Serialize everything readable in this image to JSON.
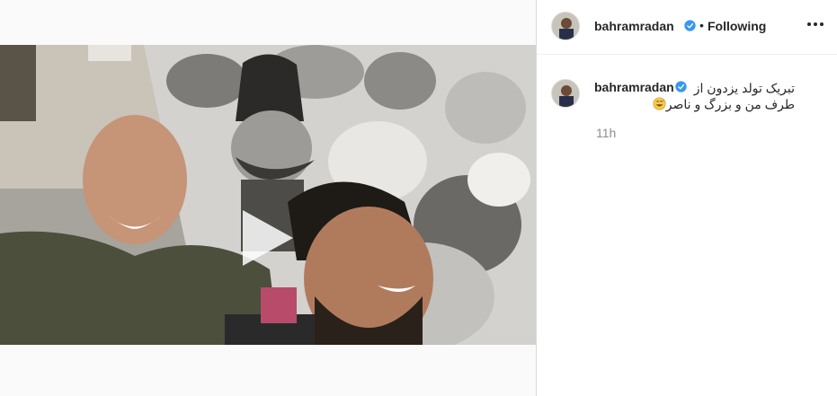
{
  "post": {
    "username": "bahramradan",
    "follow_status": "Following",
    "separator": "•",
    "caption_line1": "تبریک تولد یزدون از",
    "caption_line2": "طرف من و بزرگ و ناصر",
    "timestamp": "11h"
  },
  "icons": {
    "verified": "verified-badge-icon",
    "more": "more-options-icon",
    "play": "play-icon",
    "user_tag": "user-tag-icon",
    "emoji": "grinning-sweat-emoji-icon"
  },
  "colors": {
    "verified_blue": "#3897f0",
    "text": "#262626",
    "secondary_text": "#8e8e8e",
    "border": "#dbdbdb"
  }
}
